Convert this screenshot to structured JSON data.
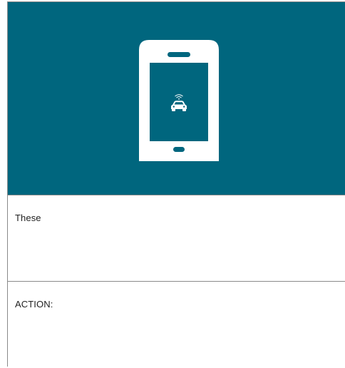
{
  "colors": {
    "hero_background": "#00667e",
    "icon_color": "#ffffff",
    "divider": "#8a8a8a",
    "text": "#222222"
  },
  "hero": {
    "icon": "smartphone-car-icon"
  },
  "sections": [
    {
      "text": "These"
    },
    {
      "text": "ACTION:"
    }
  ]
}
